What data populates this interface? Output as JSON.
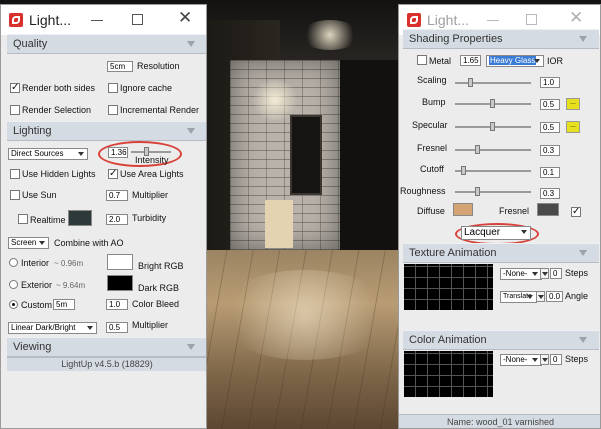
{
  "left_panel": {
    "title": "Light...",
    "quality": {
      "header": "Quality",
      "resolution_value": "5cm",
      "resolution_label": "Resolution",
      "render_both_sides": "Render both sides",
      "ignore_cache": "Ignore cache",
      "render_selection": "Render Selection",
      "incremental_render": "Incremental Render"
    },
    "lighting": {
      "header": "Lighting",
      "source_select": "Direct Sources",
      "intensity_value": "1.36",
      "intensity_label": "Intensity",
      "use_hidden_lights": "Use Hidden Lights",
      "use_area_lights": "Use Area Lights",
      "use_sun": "Use Sun",
      "multiplier_value": "0.7",
      "multiplier_label": "Multiplier",
      "realtime": "Realtime",
      "turbidity_value": "2.0",
      "turbidity_label": "Turbidity",
      "ao_select": "Screen",
      "combine_ao": "Combine with AO",
      "interior": "Interior",
      "interior_dist": "~ 0.96m",
      "bright_rgb": "Bright RGB",
      "exterior": "Exterior",
      "exterior_dist": "~ 9.64m",
      "dark_rgb": "Dark RGB",
      "custom": "Custom",
      "custom_value": "5m",
      "color_bleed_value": "1.0",
      "color_bleed_label": "Color Bleed",
      "tonemap_select": "Linear Dark/Bright",
      "multiplier2_value": "0.5",
      "multiplier2_label": "Multiplier"
    },
    "viewing": {
      "header": "Viewing"
    },
    "status": "LightUp v4.5.b (18829)",
    "colors": {
      "swatch_dark": "#2e3a3a",
      "bright": "#ffffff",
      "dark": "#000000"
    }
  },
  "right_panel": {
    "title": "Light...",
    "shading": {
      "header": "Shading Properties",
      "metal": "Metal",
      "ior_value": "1.65",
      "glass_select": "Heavy Glass",
      "ior_label": "IOR",
      "scaling_label": "Scaling",
      "scaling_value": "1.0",
      "bump_label": "Bump",
      "bump_value": "0.5",
      "specular_label": "Specular",
      "specular_value": "0.5",
      "fresnel_label": "Fresnel",
      "fresnel_value": "0.3",
      "cutoff_label": "Cutoff",
      "cutoff_value": "0.1",
      "roughness_label": "Roughness",
      "roughness_value": "0.3",
      "diffuse_label": "Diffuse",
      "fresnel_swatch_label": "Fresnel",
      "material_select": "Lacquer",
      "yellow_btn_label": "...",
      "colors": {
        "diffuse": "#d4a373",
        "fresnel": "#4a4a4a"
      }
    },
    "texture_animation": {
      "header": "Texture Animation",
      "select1": "-None-",
      "steps_value": "0",
      "steps_label": "Steps",
      "select2": "Translate",
      "angle_value": "0.0",
      "angle_label": "Angle"
    },
    "color_animation": {
      "header": "Color Animation",
      "select": "-None-",
      "steps_value": "0",
      "steps_label": "Steps"
    },
    "status": "Name: wood_01 varnished"
  }
}
